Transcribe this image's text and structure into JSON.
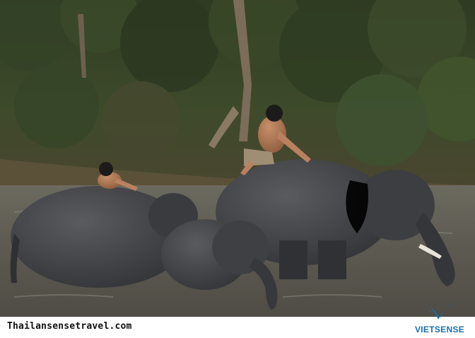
{
  "footer": {
    "url_text": "Thailansensetravel.com"
  },
  "brand": {
    "name": "VIETSENSE",
    "color": "#1a6fb0"
  },
  "photo": {
    "icon": "landscape-photo"
  }
}
